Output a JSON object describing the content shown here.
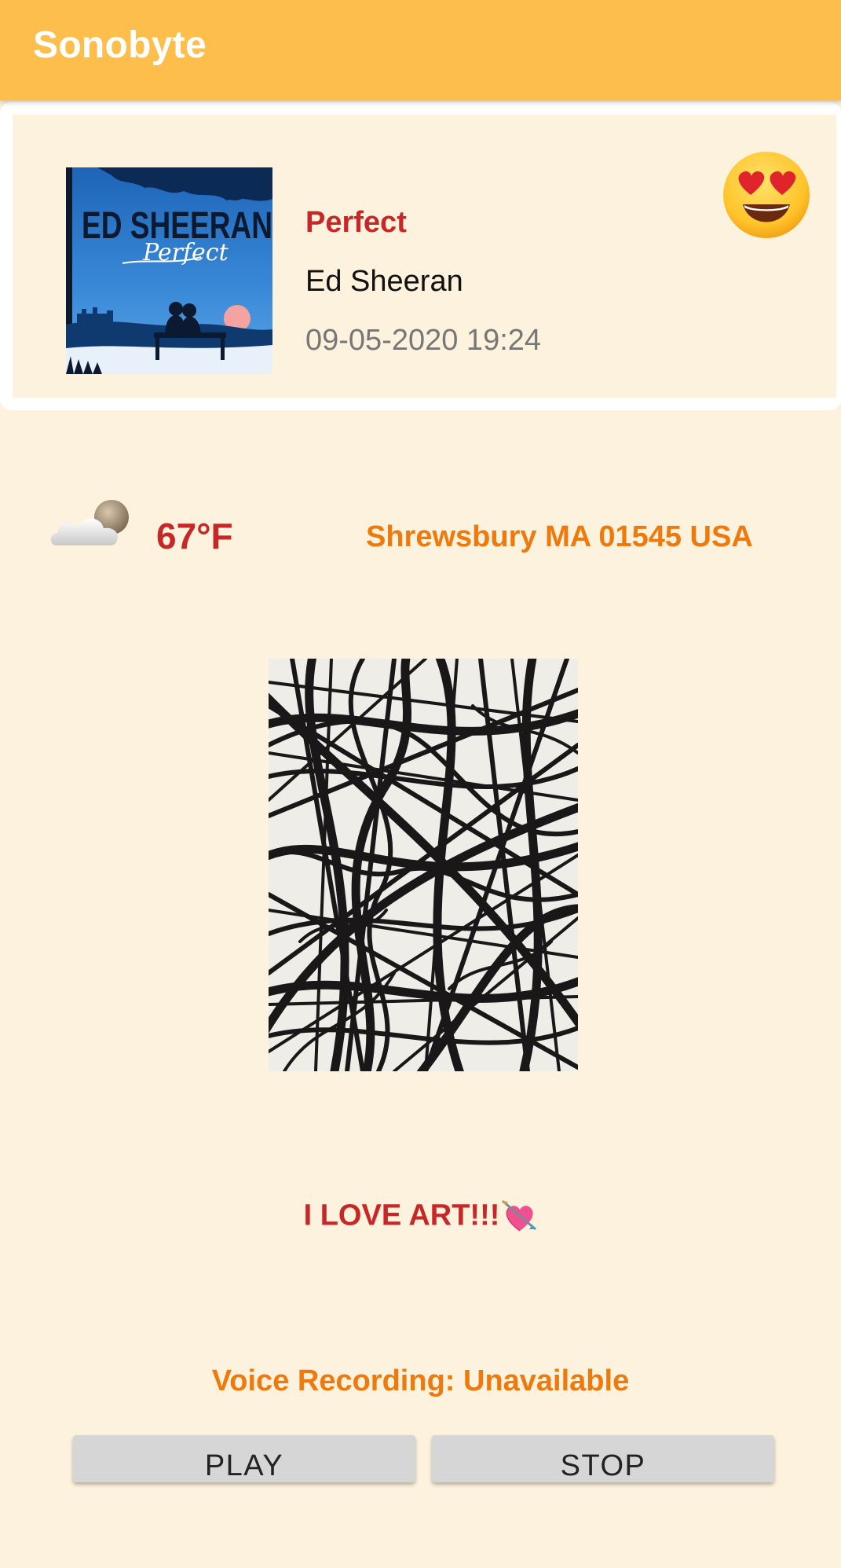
{
  "app_bar": {
    "title": "Sonobyte",
    "background_color": "#FDBE4C"
  },
  "song_card": {
    "album_art": {
      "icon": "album-cover-image",
      "text_line1": "ED SHEERAN",
      "text_line2": "Perfect"
    },
    "title": "Perfect",
    "artist": "Ed Sheeran",
    "datetime": "09-05-2020 19:24",
    "mood_icon": "heart-eyes-emoji-icon"
  },
  "weather": {
    "icon": "partly-cloudy-night-icon",
    "temperature": "67°F",
    "location": "Shrewsbury MA 01545 USA"
  },
  "artwork": {
    "icon": "abstract-line-art-image"
  },
  "message": {
    "text": "I LOVE ART!!!",
    "icon": "heart-with-arrow-icon"
  },
  "voice_recording": {
    "status": "Voice Recording: Unavailable"
  },
  "buttons": {
    "play_label": "PLAY",
    "stop_label": "STOP"
  },
  "colors": {
    "background": "#FDF2DD",
    "title_red": "#C62828",
    "accent_orange": "#EE7A0D",
    "date_gray": "#777777",
    "button_gray": "#D6D6D6"
  }
}
